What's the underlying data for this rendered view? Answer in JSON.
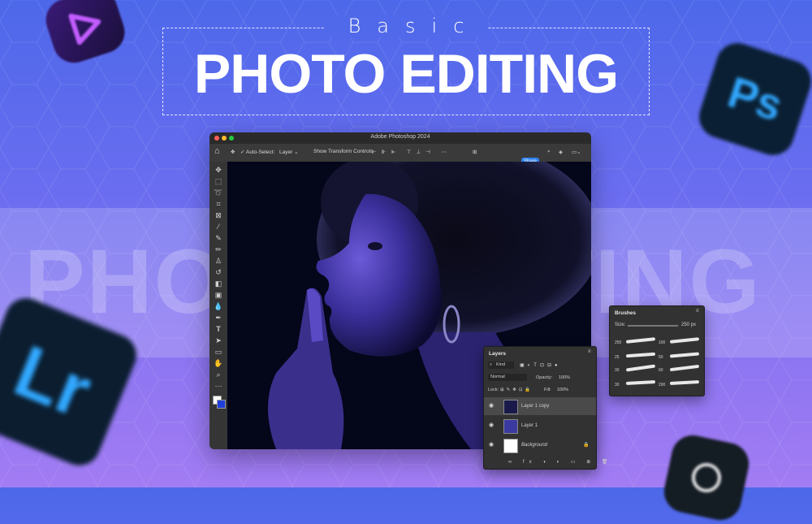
{
  "heading": {
    "kicker": "Basic",
    "title": "PHOTO EDITING",
    "ghost_text": "PHOTO EDITING"
  },
  "app_icons": [
    {
      "name": "premiere-rush-icon",
      "glyph": "▷",
      "color": "#c05bff"
    },
    {
      "name": "photoshop-icon",
      "glyph": "Ps",
      "color": "#31a8ff"
    },
    {
      "name": "lightroom-icon",
      "glyph": "Lr",
      "color": "#31a8ff"
    },
    {
      "name": "camera-raw-icon",
      "glyph": "O",
      "color": "#ffffff"
    }
  ],
  "window": {
    "title": "Adobe Photoshop 2024",
    "options": {
      "auto_select": "Auto-Select:",
      "layer_select": "Layer",
      "transform": "Show Transform Controls",
      "share": "Share"
    }
  },
  "layers_panel": {
    "title": "Layers",
    "kind": "Kind",
    "blend_mode": "Normal",
    "opacity_label": "Opacity:",
    "opacity_value": "100%",
    "lock_label": "Lock:",
    "fill_label": "Fill:",
    "fill_value": "100%",
    "layers": [
      {
        "name": "Layer 1 copy"
      },
      {
        "name": "Layer 1"
      },
      {
        "name": "Background"
      }
    ]
  },
  "brushes_panel": {
    "title": "Brushes",
    "size_label": "Size:",
    "size_value": "250 px",
    "sizes": [
      "250",
      "25",
      "30",
      "30",
      "100",
      "50",
      "60",
      "200"
    ]
  },
  "colors": {
    "accent": "#2f80ed",
    "background_top": "#4d68ea",
    "background_bottom": "#a27cf3"
  }
}
